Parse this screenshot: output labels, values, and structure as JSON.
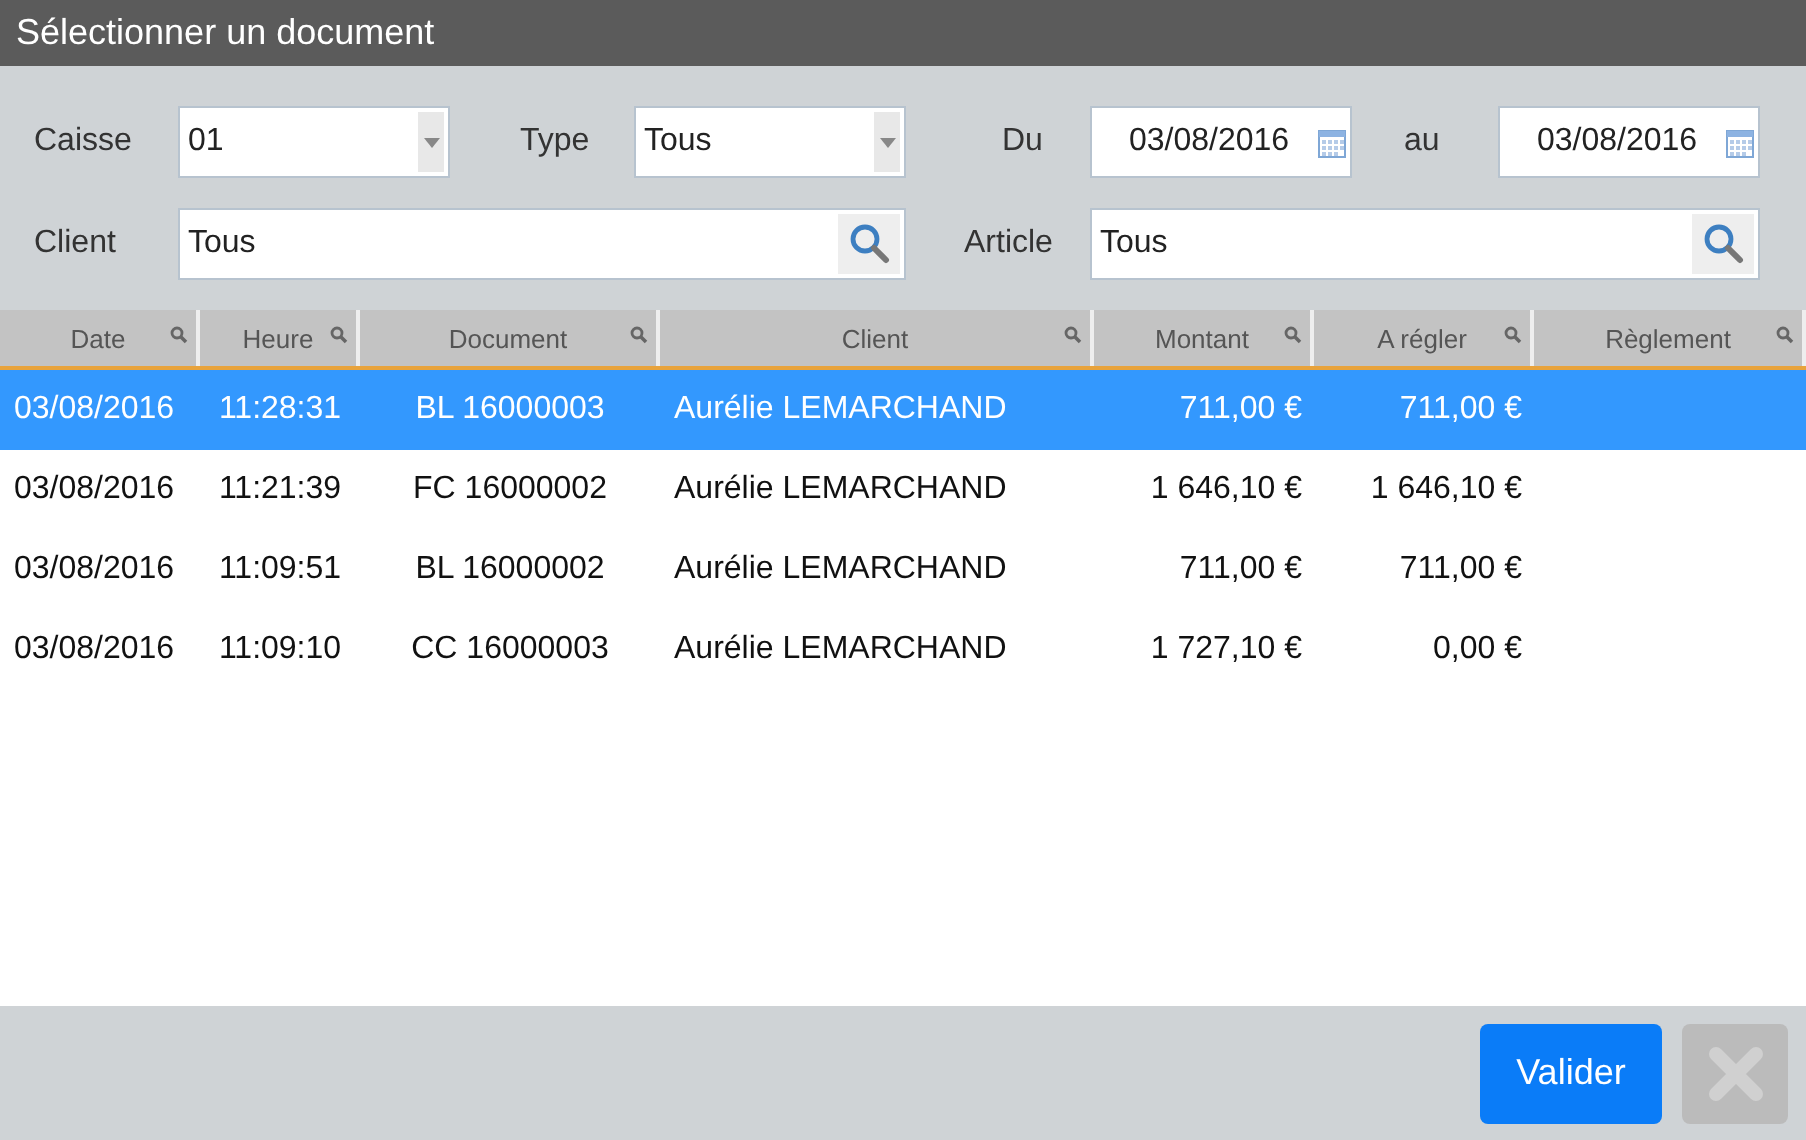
{
  "window": {
    "title": "Sélectionner un document"
  },
  "filters": {
    "caisse": {
      "label": "Caisse",
      "value": "01"
    },
    "type": {
      "label": "Type",
      "value": "Tous"
    },
    "du": {
      "label": "Du",
      "value": "03/08/2016"
    },
    "au": {
      "label": "au",
      "value": "03/08/2016"
    },
    "client": {
      "label": "Client",
      "value": "Tous"
    },
    "article": {
      "label": "Article",
      "value": "Tous"
    }
  },
  "table": {
    "columns": [
      {
        "label": "Date"
      },
      {
        "label": "Heure"
      },
      {
        "label": "Document"
      },
      {
        "label": "Client"
      },
      {
        "label": "Montant"
      },
      {
        "label": "A régler"
      },
      {
        "label": "Règlement"
      }
    ],
    "rows": [
      {
        "selected": true,
        "cells": [
          "03/08/2016",
          "11:28:31",
          "BL 16000003",
          "Aurélie LEMARCHAND",
          "711,00 €",
          "711,00 €"
        ]
      },
      {
        "selected": false,
        "cells": [
          "03/08/2016",
          "11:21:39",
          "FC 16000002",
          "Aurélie LEMARCHAND",
          "1 646,10 €",
          "1 646,10 €"
        ]
      },
      {
        "selected": false,
        "cells": [
          "03/08/2016",
          "11:09:51",
          "BL 16000002",
          "Aurélie LEMARCHAND",
          "711,00 €",
          "711,00 €"
        ]
      },
      {
        "selected": false,
        "cells": [
          "03/08/2016",
          "11:09:10",
          "CC 16000003",
          "Aurélie LEMARCHAND",
          "1 727,10 €",
          "0,00 €"
        ]
      }
    ]
  },
  "buttons": {
    "validate": {
      "label": "Valider"
    },
    "close": {
      "disabled": true
    }
  }
}
